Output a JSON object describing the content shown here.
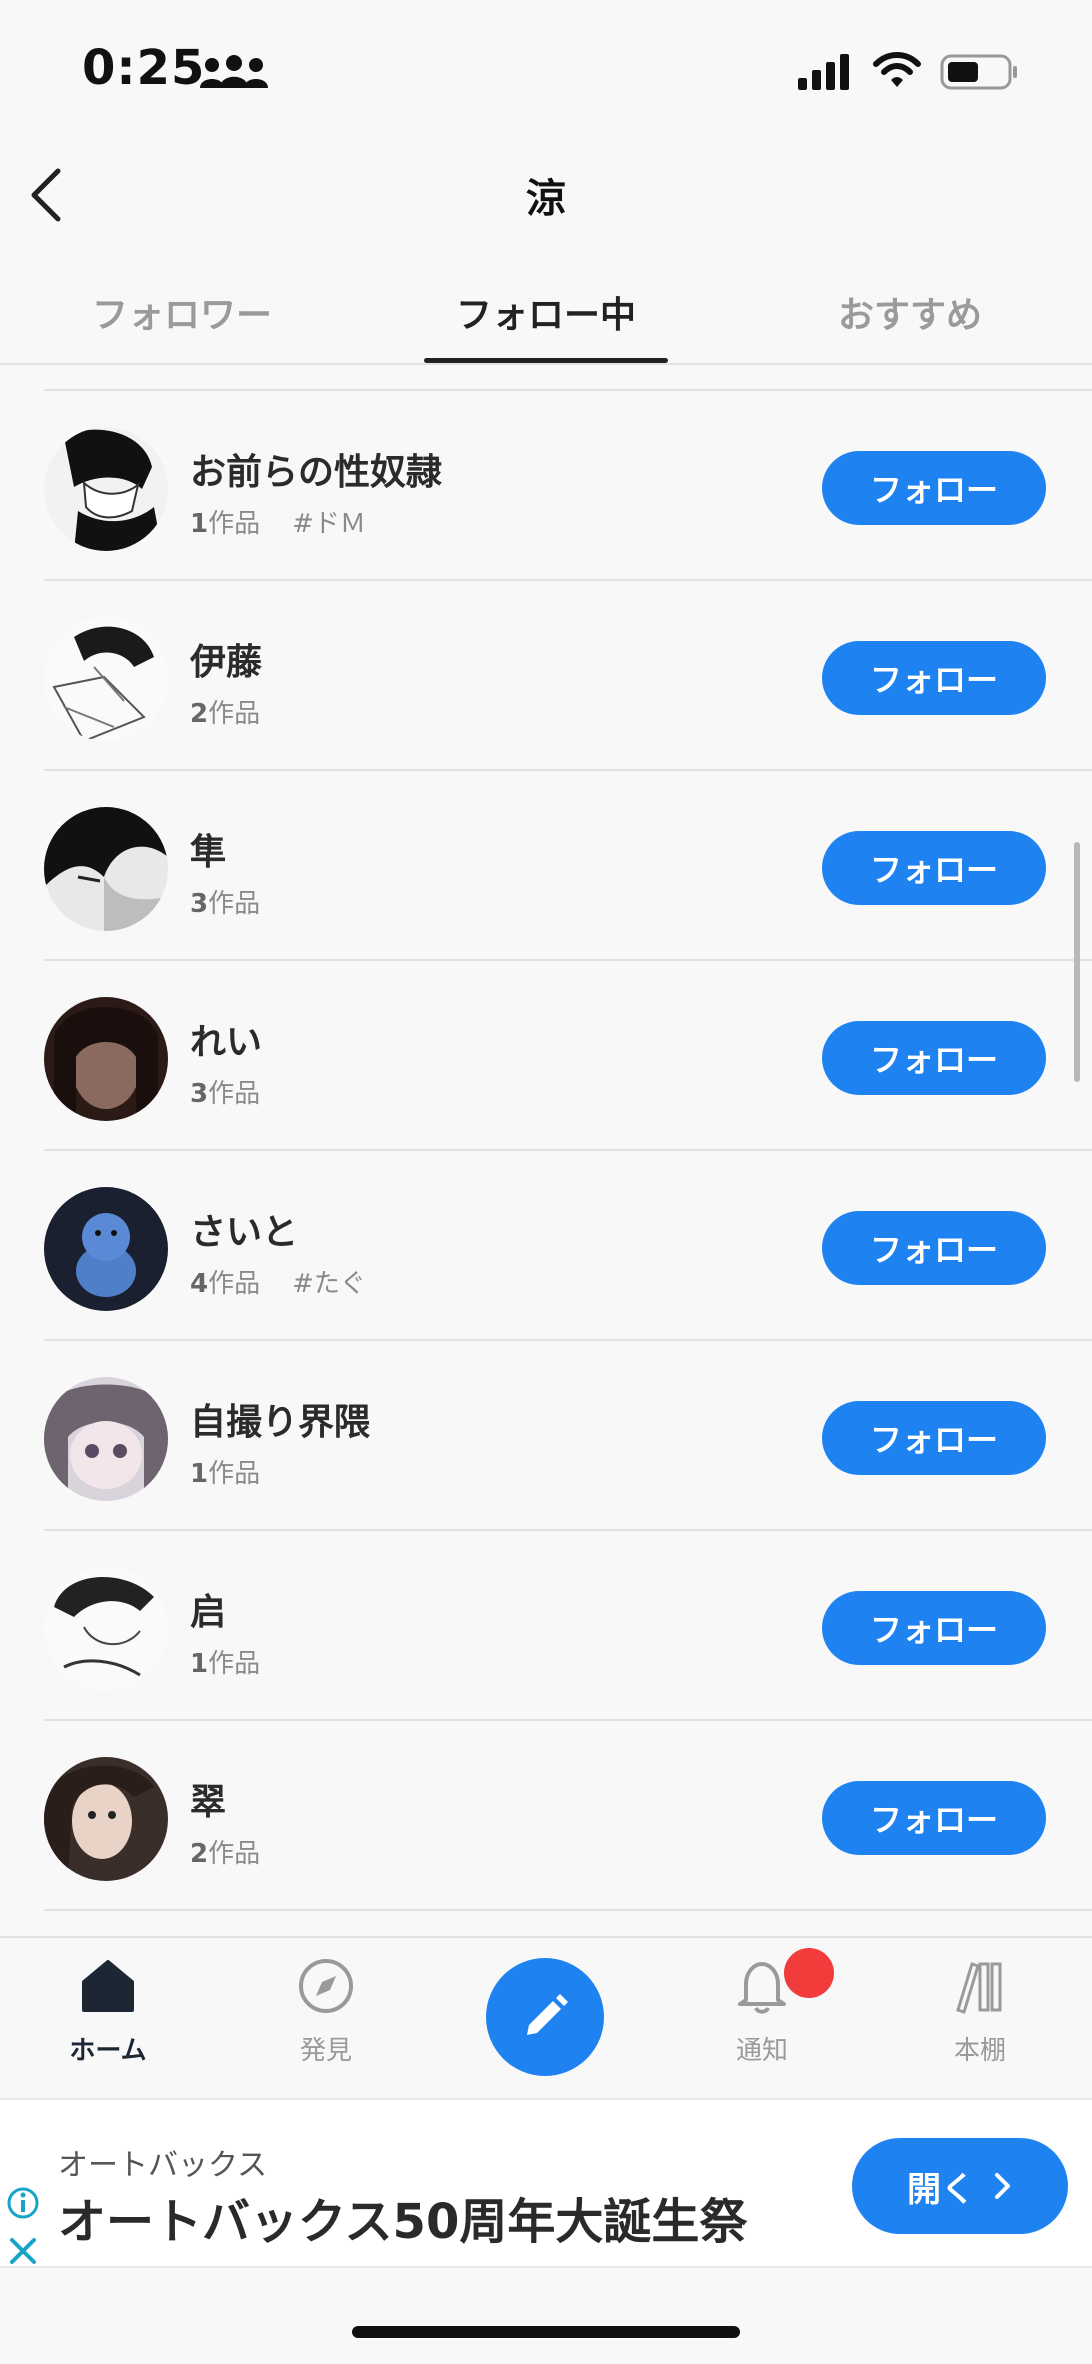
{
  "status_bar": {
    "time": "0:25",
    "icons": [
      "people-icon",
      "signal-icon",
      "wifi-icon",
      "battery-icon"
    ]
  },
  "header": {
    "title": "涼",
    "back_icon": "chevron-left-icon"
  },
  "tabs": [
    {
      "label": "フォロワー",
      "active": false
    },
    {
      "label": "フォロー中",
      "active": true
    },
    {
      "label": "おすすめ",
      "active": false
    }
  ],
  "users": [
    {
      "name": "お前らの性奴隷",
      "count": "1",
      "unit": "作品",
      "tag": "#ドＭ"
    },
    {
      "name": "伊藤",
      "count": "2",
      "unit": "作品",
      "tag": ""
    },
    {
      "name": "隼",
      "count": "3",
      "unit": "作品",
      "tag": ""
    },
    {
      "name": "れい",
      "count": "3",
      "unit": "作品",
      "tag": ""
    },
    {
      "name": "さいと",
      "count": "4",
      "unit": "作品",
      "tag": "#たぐ"
    },
    {
      "name": "自撮り界隈",
      "count": "1",
      "unit": "作品",
      "tag": ""
    },
    {
      "name": "启",
      "count": "1",
      "unit": "作品",
      "tag": ""
    },
    {
      "name": "翠",
      "count": "2",
      "unit": "作品",
      "tag": ""
    }
  ],
  "follow_label": "フォロー",
  "bottom_nav": {
    "home": "ホーム",
    "discover": "発見",
    "notifications": "通知",
    "bookshelf": "本棚"
  },
  "ad": {
    "advertiser": "オートバックス",
    "headline": "オートバックス50周年大誕生祭",
    "button_label": "開く"
  },
  "colors": {
    "accent": "#1e83f0",
    "badge": "#f23b3b",
    "background": "#f8f8f8"
  }
}
